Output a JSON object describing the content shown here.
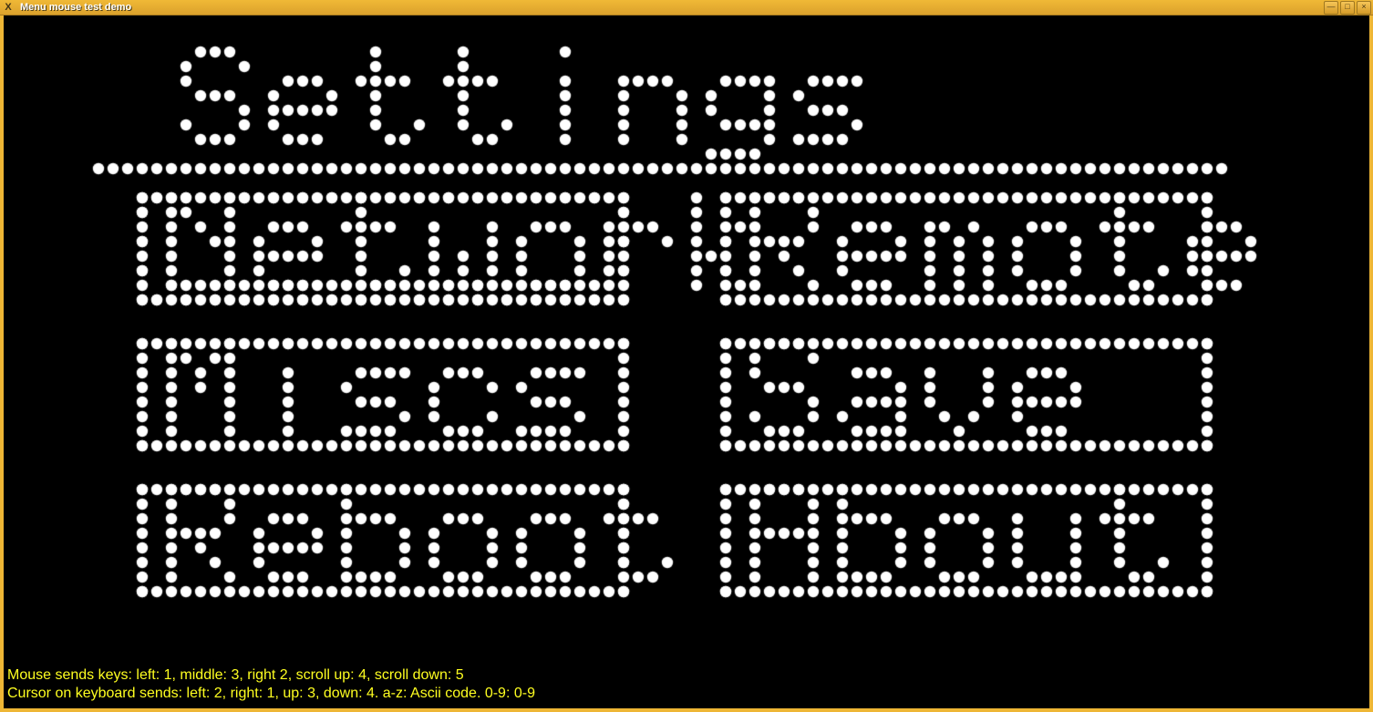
{
  "window": {
    "title": "Menu mouse test demo"
  },
  "menu": {
    "heading": "Settings",
    "items": [
      {
        "label": "Network",
        "selected": true
      },
      {
        "label": "Remote",
        "selected": false
      },
      {
        "label": "Miscs",
        "selected": false
      },
      {
        "label": "Save",
        "selected": false
      },
      {
        "label": "Reboot",
        "selected": false
      },
      {
        "label": "About",
        "selected": false
      }
    ]
  },
  "footer": {
    "line1": "Mouse sends keys: left: 1, middle: 3, right 2, scroll up: 4, scroll down: 5",
    "line2": "Cursor on keyboard sends: left: 2, right: 1, up: 3, down: 4. a-z: Ascii code. 0-9: 0-9"
  },
  "led": {
    "dot_color": "#ffffff",
    "dim_color": "#808080",
    "dot_radius": 6.2,
    "pitch": 16.0
  }
}
